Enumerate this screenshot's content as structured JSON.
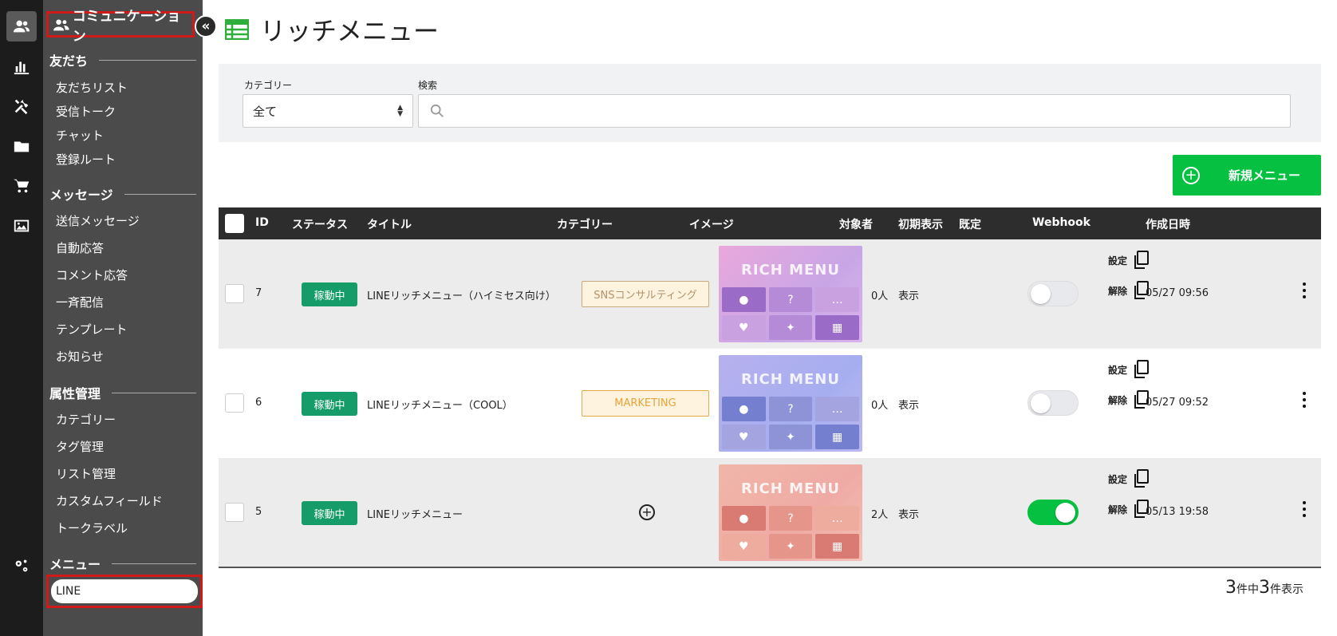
{
  "sidebar": {
    "title": "コミュニケーション",
    "collapse_glyph": "«",
    "sections": [
      {
        "heading": "友だち",
        "items": [
          "友だちリスト",
          "受信トーク",
          "チャット",
          "登録ルート"
        ]
      },
      {
        "heading": "メッセージ",
        "items": [
          "送信メッセージ",
          "自動応答",
          "コメント応答",
          "一斉配信",
          "テンプレート",
          "お知らせ"
        ]
      },
      {
        "heading": "属性管理",
        "items": [
          "カテゴリー",
          "タグ管理",
          "リスト管理",
          "カスタムフィールド",
          "トークラベル"
        ]
      },
      {
        "heading": "メニュー",
        "items": [
          "LINE"
        ]
      }
    ]
  },
  "page": {
    "title": "リッチメニュー"
  },
  "filter": {
    "category_label": "カテゴリー",
    "category_value": "全て",
    "search_label": "検索",
    "search_placeholder": ""
  },
  "new_button": {
    "label": "新規メニュー"
  },
  "table": {
    "headers": [
      "ID",
      "ステータス",
      "タイトル",
      "カテゴリー",
      "イメージ",
      "対象者",
      "初期表示",
      "既定",
      "Webhook",
      "作成日時"
    ],
    "rows": [
      {
        "id": "7",
        "status": "稼動中",
        "title": "LINEリッチメニュー（ハイミセス向け）",
        "category": "SNSコンサルティング",
        "image_text": "RICH MENU",
        "target": "0人",
        "initial": "表示",
        "default_on": false,
        "webhook_set": "設定",
        "webhook_unset": "解除",
        "created": "05/27 09:56"
      },
      {
        "id": "6",
        "status": "稼動中",
        "title": "LINEリッチメニュー（COOL）",
        "category": "MARKETING",
        "image_text": "RICH MENU",
        "target": "0人",
        "initial": "表示",
        "default_on": false,
        "webhook_set": "設定",
        "webhook_unset": "解除",
        "created": "05/27 09:52"
      },
      {
        "id": "5",
        "status": "稼動中",
        "title": "LINEリッチメニュー",
        "category": "",
        "image_text": "RICH MENU",
        "target": "2人",
        "initial": "表示",
        "default_on": true,
        "webhook_set": "設定",
        "webhook_unset": "解除",
        "created": "05/13 19:58"
      }
    ]
  },
  "footer": {
    "total": "3",
    "of_label": "件中",
    "shown": "3",
    "shown_label": "件表示"
  },
  "colors": {
    "accent_green": "#06c141",
    "status_green": "#169c69",
    "highlight_red": "#d01a1a"
  }
}
